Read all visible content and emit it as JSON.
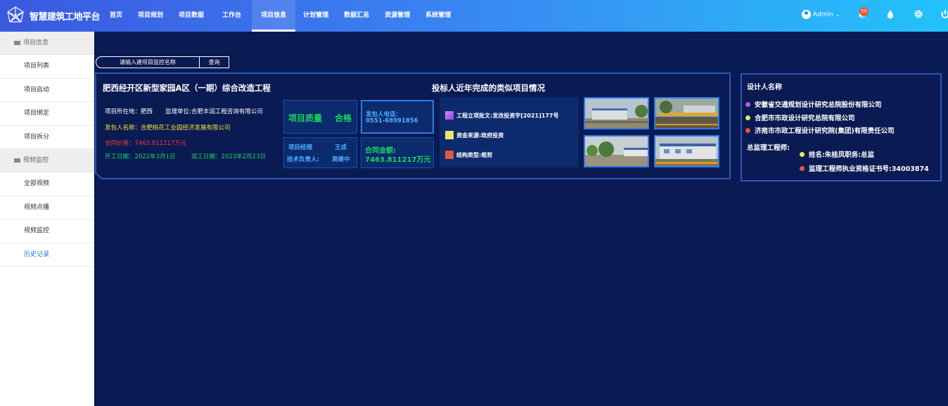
{
  "app": {
    "title": "智慧建筑工地平台"
  },
  "nav": [
    {
      "label": "首页"
    },
    {
      "label": "项目规划"
    },
    {
      "label": "项目数据"
    },
    {
      "label": "工作台"
    },
    {
      "label": "项目信息"
    },
    {
      "label": "计划管理"
    },
    {
      "label": "数据汇总"
    },
    {
      "label": "资源管理"
    },
    {
      "label": "系统管理"
    }
  ],
  "header": {
    "user": "Admin",
    "notification_count": "50"
  },
  "sidebar": {
    "groups": [
      {
        "label": "项目信息",
        "items": [
          {
            "label": "项目列表"
          },
          {
            "label": "项目启动"
          },
          {
            "label": "项目绑定"
          },
          {
            "label": "项目拆分"
          }
        ]
      },
      {
        "label": "视频监控",
        "items": [
          {
            "label": "全部视频"
          },
          {
            "label": "视频点播"
          },
          {
            "label": "视频监控"
          },
          {
            "label": "历史记录"
          }
        ]
      }
    ]
  },
  "search": {
    "placeholder": "请输入建项目监控名称",
    "button": "查询"
  },
  "project": {
    "title": "肥西经开区新型家园A区（一期）综合改造工程",
    "location": "项目所在地：肥西",
    "supervisor": "监理单位:合肥丰润工程咨询有限公司",
    "contractor": "发包人名称：合肥桃花工业园经济发展有限公司",
    "contract_price": "合同价格：7463.811217万元",
    "start_date": "开工日期：2022年3月1日",
    "end_date": "竣工日期：2023年2月23日",
    "quality_label": "项目质量",
    "quality_value": "合格",
    "manager_label": "项目经理",
    "manager_value": "王成",
    "tech_label": "技术负责人:",
    "tech_value": "周继中",
    "phone_label": "发包人电话：",
    "phone_value": "0551-68991856",
    "amount_label": "合同金额:",
    "amount_value": "7463.811217万元"
  },
  "similar": {
    "title": "投标人近年完成的类似项目情况",
    "items": [
      {
        "label": "工程立项批文:发改投资字[2021]177号",
        "color": "#b45ce8"
      },
      {
        "label": "资金来源:政府投资",
        "color": "#f2e36a"
      },
      {
        "label": "结构类型:框剪",
        "color": "#e2553e"
      }
    ],
    "photos": [
      {
        "name": "site-photo"
      },
      {
        "name": "site-photo"
      },
      {
        "name": "site-photo"
      },
      {
        "name": "site-photo"
      }
    ]
  },
  "designer": {
    "title": "设计人名称",
    "items": [
      {
        "label": "安徽省交通规划设计研究总院股份有限公司",
        "color": "#b45ce8"
      },
      {
        "label": "合肥市市政设计研究总院有限公司",
        "color": "#f2e36a"
      },
      {
        "label": "济南市市政工程设计研究院(集团)有限责任公司",
        "color": "#e2553e"
      }
    ],
    "chief_title": "总监理工程师:",
    "chief_items": [
      {
        "label": "姓名:朱桂凤职务:总监",
        "color": "#f2e36a"
      },
      {
        "label": "监理工程师执业资格证书号:34003874",
        "color": "#e2553e"
      }
    ]
  },
  "colors": {
    "background": "#0a1a52",
    "accent": "#2f7ae8",
    "green": "#17d65a",
    "yellow": "#f5e33b",
    "red": "#f23b3b"
  }
}
